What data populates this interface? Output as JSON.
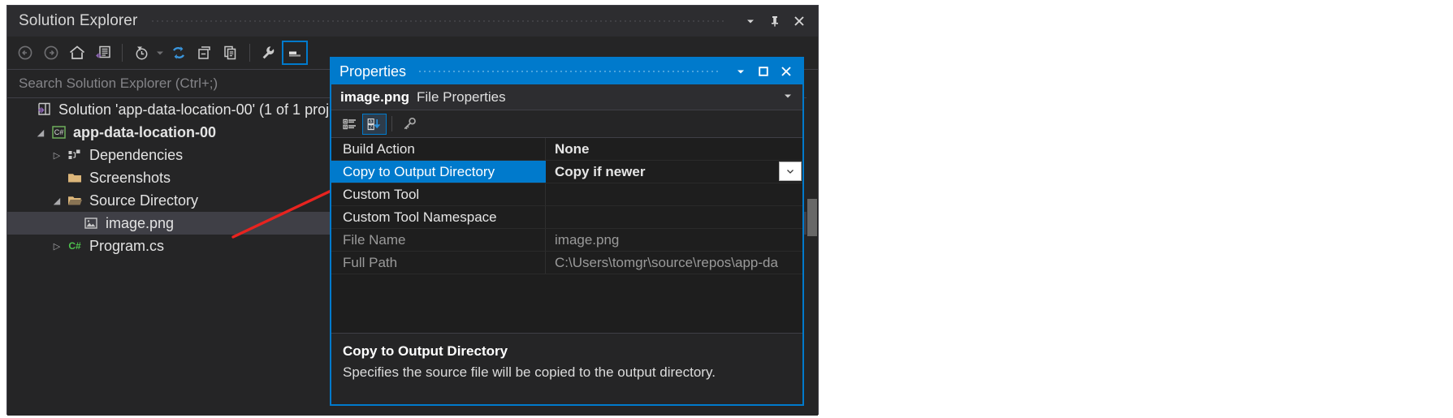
{
  "solution_explorer": {
    "title": "Solution Explorer",
    "titlebar_buttons": [
      {
        "name": "chevron-down-icon",
        "label": "▾"
      },
      {
        "name": "pin-icon",
        "label": "⚐"
      },
      {
        "name": "close-icon",
        "label": "✕"
      }
    ],
    "toolbar": [
      {
        "name": "back-icon",
        "tooltip": "Back"
      },
      {
        "name": "forward-icon",
        "tooltip": "Forward"
      },
      {
        "name": "home-icon",
        "tooltip": "Home"
      },
      {
        "name": "solution-explorer-icon",
        "tooltip": "Solution Explorer"
      },
      {
        "name": "pending-changes-icon",
        "tooltip": "Pending Changes Filter"
      },
      {
        "name": "refresh-icon",
        "tooltip": "Refresh"
      },
      {
        "name": "collapse-all-icon",
        "tooltip": "Collapse All"
      },
      {
        "name": "show-all-files-icon",
        "tooltip": "Show All Files"
      },
      {
        "name": "properties-wrench-icon",
        "tooltip": "Properties"
      },
      {
        "name": "preview-selected-items-icon",
        "tooltip": "Preview Selected Items"
      }
    ],
    "search": {
      "placeholder": "Search Solution Explorer (Ctrl+;)",
      "value": ""
    },
    "tree": [
      {
        "label": "Solution 'app-data-location-00' (1 of 1 proj",
        "icon": "visual-studio-solution-icon",
        "indent": 0,
        "twisty": "",
        "bold": false,
        "selected": false
      },
      {
        "label": "app-data-location-00",
        "icon": "csharp-project-icon",
        "indent": 1,
        "twisty": "◢",
        "bold": true,
        "selected": false
      },
      {
        "label": "Dependencies",
        "icon": "dependencies-icon",
        "indent": 2,
        "twisty": "▷",
        "bold": false,
        "selected": false
      },
      {
        "label": "Screenshots",
        "icon": "folder-closed-icon",
        "indent": 2,
        "twisty": "",
        "bold": false,
        "selected": false
      },
      {
        "label": "Source Directory",
        "icon": "folder-open-icon",
        "indent": 2,
        "twisty": "◢",
        "bold": false,
        "selected": false
      },
      {
        "label": "image.png",
        "icon": "image-file-icon",
        "indent": 3,
        "twisty": "",
        "bold": false,
        "selected": true
      },
      {
        "label": "Program.cs",
        "icon": "csharp-file-icon",
        "indent": 2,
        "twisty": "▷",
        "bold": false,
        "selected": false
      }
    ]
  },
  "properties_window": {
    "title": "Properties",
    "titlebar_buttons": [
      {
        "name": "chevron-down-icon",
        "label": "▾"
      },
      {
        "name": "maximize-icon",
        "label": "❐"
      },
      {
        "name": "close-icon",
        "label": "✕"
      }
    ],
    "object_name": "image.png",
    "object_type": "File Properties",
    "toolbar": [
      {
        "name": "categorized-view-icon",
        "selected": false
      },
      {
        "name": "alphabetical-sort-icon",
        "selected": true
      },
      {
        "name": "properties-key-icon",
        "selected": false
      }
    ],
    "grid": [
      {
        "name": "Build Action",
        "value": "None",
        "readonly": false,
        "selected": false,
        "dropdown": false
      },
      {
        "name": "Copy to Output Directory",
        "value": "Copy if newer",
        "readonly": false,
        "selected": true,
        "dropdown": true
      },
      {
        "name": "Custom Tool",
        "value": "",
        "readonly": false,
        "selected": false,
        "dropdown": false
      },
      {
        "name": "Custom Tool Namespace",
        "value": "",
        "readonly": false,
        "selected": false,
        "dropdown": false
      },
      {
        "name": "File Name",
        "value": "image.png",
        "readonly": true,
        "selected": false,
        "dropdown": false
      },
      {
        "name": "Full Path",
        "value": "C:\\Users\\tomgr\\source\\repos\\app-da",
        "readonly": true,
        "selected": false,
        "dropdown": false
      }
    ],
    "description": {
      "title": "Copy to Output Directory",
      "body": "Specifies the source file will be copied to the output directory."
    }
  },
  "annotation": {
    "name": "red-arrow",
    "color": "#e8231f"
  },
  "colors": {
    "accent": "#007acc",
    "window_bg": "#252526",
    "grid_bg": "#1e1e1e",
    "selection": "#3f3f46"
  }
}
